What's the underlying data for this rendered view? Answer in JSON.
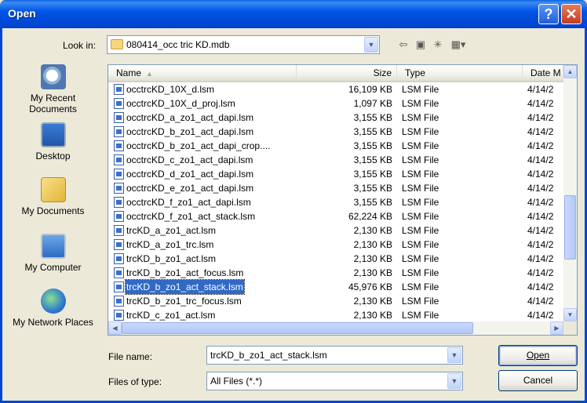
{
  "window": {
    "title": "Open",
    "help_label": "?",
    "close_label": "✕"
  },
  "lookin": {
    "label": "Look in:",
    "value": "080414_occ tric KD.mdb",
    "icons": [
      "back-icon",
      "up-folder-icon",
      "new-folder-icon",
      "views-menu-icon"
    ]
  },
  "places": [
    {
      "name": "place-my-recent-documents",
      "icon": "recent-documents-icon",
      "label": "My Recent Documents"
    },
    {
      "name": "place-desktop",
      "icon": "desktop-icon",
      "label": "Desktop"
    },
    {
      "name": "place-my-documents",
      "icon": "my-documents-icon",
      "label": "My Documents"
    },
    {
      "name": "place-my-computer",
      "icon": "my-computer-icon",
      "label": "My Computer"
    },
    {
      "name": "place-my-network-places",
      "icon": "network-places-icon",
      "label": "My Network Places"
    }
  ],
  "columns": {
    "name": "Name",
    "size": "Size",
    "type": "Type",
    "date": "Date M"
  },
  "files": [
    {
      "name": "occtrcKD_10X_d.lsm",
      "size": "16,109 KB",
      "type": "LSM File",
      "date": "4/14/2"
    },
    {
      "name": "occtrcKD_10X_d_proj.lsm",
      "size": "1,097 KB",
      "type": "LSM File",
      "date": "4/14/2"
    },
    {
      "name": "occtrcKD_a_zo1_act_dapi.lsm",
      "size": "3,155 KB",
      "type": "LSM File",
      "date": "4/14/2"
    },
    {
      "name": "occtrcKD_b_zo1_act_dapi.lsm",
      "size": "3,155 KB",
      "type": "LSM File",
      "date": "4/14/2"
    },
    {
      "name": "occtrcKD_b_zo1_act_dapi_crop....",
      "size": "3,155 KB",
      "type": "LSM File",
      "date": "4/14/2"
    },
    {
      "name": "occtrcKD_c_zo1_act_dapi.lsm",
      "size": "3,155 KB",
      "type": "LSM File",
      "date": "4/14/2"
    },
    {
      "name": "occtrcKD_d_zo1_act_dapi.lsm",
      "size": "3,155 KB",
      "type": "LSM File",
      "date": "4/14/2"
    },
    {
      "name": "occtrcKD_e_zo1_act_dapi.lsm",
      "size": "3,155 KB",
      "type": "LSM File",
      "date": "4/14/2"
    },
    {
      "name": "occtrcKD_f_zo1_act_dapi.lsm",
      "size": "3,155 KB",
      "type": "LSM File",
      "date": "4/14/2"
    },
    {
      "name": "occtrcKD_f_zo1_act_stack.lsm",
      "size": "62,224 KB",
      "type": "LSM File",
      "date": "4/14/2"
    },
    {
      "name": "trcKD_a_zo1_act.lsm",
      "size": "2,130 KB",
      "type": "LSM File",
      "date": "4/14/2"
    },
    {
      "name": "trcKD_a_zo1_trc.lsm",
      "size": "2,130 KB",
      "type": "LSM File",
      "date": "4/14/2"
    },
    {
      "name": "trcKD_b_zo1_act.lsm",
      "size": "2,130 KB",
      "type": "LSM File",
      "date": "4/14/2"
    },
    {
      "name": "trcKD_b_zo1_act_focus.lsm",
      "size": "2,130 KB",
      "type": "LSM File",
      "date": "4/14/2"
    },
    {
      "name": "trcKD_b_zo1_act_stack.lsm",
      "size": "45,976 KB",
      "type": "LSM File",
      "date": "4/14/2",
      "selected": true
    },
    {
      "name": "trcKD_b_zo1_trc_focus.lsm",
      "size": "2,130 KB",
      "type": "LSM File",
      "date": "4/14/2"
    },
    {
      "name": "trcKD_c_zo1_act.lsm",
      "size": "2,130 KB",
      "type": "LSM File",
      "date": "4/14/2"
    }
  ],
  "filename": {
    "label": "File name:",
    "value": "trcKD_b_zo1_act_stack.lsm"
  },
  "filetype": {
    "label": "Files of type:",
    "value": "All Files (*.*)"
  },
  "buttons": {
    "open": "Open",
    "cancel": "Cancel"
  }
}
